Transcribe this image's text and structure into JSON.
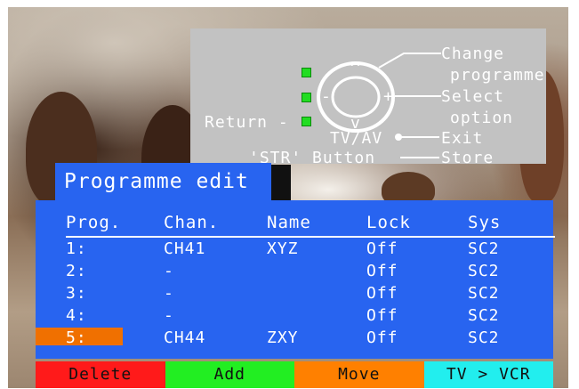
{
  "guide": {
    "change_line1": "Change",
    "change_line2": "programme",
    "select_line1": "Select",
    "select_line2": "option",
    "return_label": "Return -",
    "tvav_label": "TV/AV",
    "exit_label": "Exit",
    "str_label": "'STR' Button",
    "store_label": "Store",
    "up_glyph": "^",
    "down_glyph": "v",
    "minus_glyph": "-",
    "plus_glyph": "+"
  },
  "panel": {
    "title": "Programme edit",
    "columns": [
      "Prog.",
      "Chan.",
      "Name",
      "Lock",
      "Sys"
    ],
    "rows": [
      {
        "prog": "1:",
        "chan": "CH41",
        "name": "XYZ",
        "lock": "Off",
        "sys": "SC2"
      },
      {
        "prog": "2:",
        "chan": "-",
        "name": "",
        "lock": "Off",
        "sys": "SC2"
      },
      {
        "prog": "3:",
        "chan": "-",
        "name": "",
        "lock": "Off",
        "sys": "SC2"
      },
      {
        "prog": "4:",
        "chan": "-",
        "name": "",
        "lock": "Off",
        "sys": "SC2"
      },
      {
        "prog": "5:",
        "chan": "CH44",
        "name": "ZXY",
        "lock": "Off",
        "sys": "SC2"
      }
    ],
    "selected_row": 5
  },
  "buttons": {
    "delete": "Delete",
    "add": "Add",
    "move": "Move",
    "tv_vcr": "TV > VCR"
  },
  "colors": {
    "panel_bg": "#2864f0",
    "selected_row": "#f07000",
    "delete": "#ff1a1a",
    "add": "#22ee22",
    "move": "#ff8000",
    "tv_vcr": "#22eeee"
  }
}
